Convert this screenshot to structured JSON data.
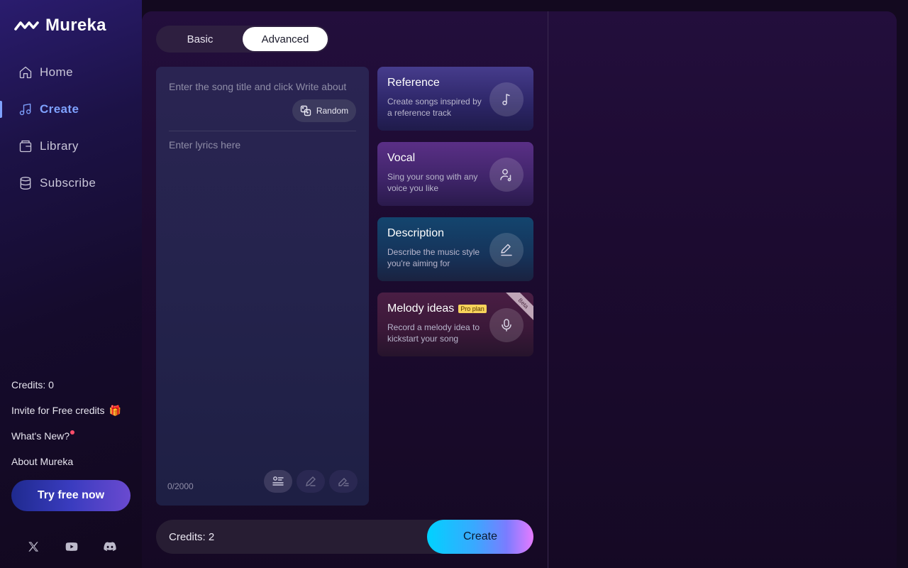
{
  "brand": {
    "name": "Mureka"
  },
  "nav": [
    {
      "label": "Home",
      "icon": "home-icon",
      "active": false
    },
    {
      "label": "Create",
      "icon": "music-note-icon",
      "active": true
    },
    {
      "label": "Library",
      "icon": "library-icon",
      "active": false
    },
    {
      "label": "Subscribe",
      "icon": "database-icon",
      "active": false
    }
  ],
  "sidebar_links": {
    "credits": "Credits: 0",
    "invite": "Invite for Free credits",
    "whats_new": "What's New?",
    "about": "About Mureka"
  },
  "try_button": "Try free now",
  "socials": [
    "x-icon",
    "youtube-icon",
    "discord-icon"
  ],
  "mode_toggle": {
    "basic": "Basic",
    "advanced": "Advanced",
    "selected": "Advanced"
  },
  "lyrics": {
    "title_placeholder": "Enter the song title and click Write about",
    "random_label": "Random",
    "lyrics_placeholder": "Enter lyrics here",
    "counter": "0/2000"
  },
  "cards": {
    "reference": {
      "title": "Reference",
      "desc": "Create songs inspired by a reference track"
    },
    "vocal": {
      "title": "Vocal",
      "desc": "Sing your song with any voice you like"
    },
    "description": {
      "title": "Description",
      "desc": "Describe the music style you're aiming for"
    },
    "melody": {
      "title": "Melody ideas",
      "badge": "Pro plan",
      "ribbon": "Beta",
      "desc": "Record a melody idea to kickstart your song"
    }
  },
  "bottom": {
    "credits": "Credits: 2",
    "create_label": "Create"
  },
  "colors": {
    "accent": "#7fa2ff",
    "background": "#13091f",
    "badge": "#f7d35b",
    "notify_dot": "#ff4d6a"
  }
}
